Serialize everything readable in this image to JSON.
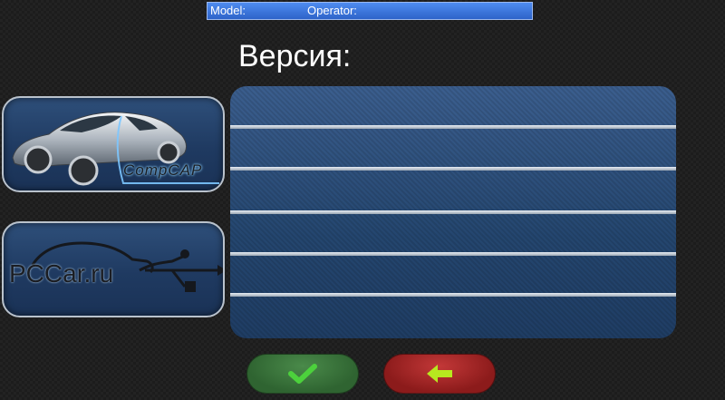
{
  "header": {
    "model_label": "Model:",
    "operator_label": "Operator:"
  },
  "page": {
    "title": "Версия:"
  },
  "sidebar": {
    "compcar_logo_text": "CompCAP",
    "pccar_logo_text": "PCCar.ru"
  },
  "version_panel": {
    "rows": [
      "",
      "",
      "",
      "",
      "",
      ""
    ]
  },
  "footer": {
    "ok_icon": "checkmark-icon",
    "back_icon": "arrow-left-icon"
  },
  "colors": {
    "topbar": "#3f7be0",
    "panel": "#24466f",
    "ok": "#2f6431",
    "back": "#8c1b1b",
    "icon_green": "#4cd13c",
    "icon_yellow_green": "#b7e81f"
  }
}
